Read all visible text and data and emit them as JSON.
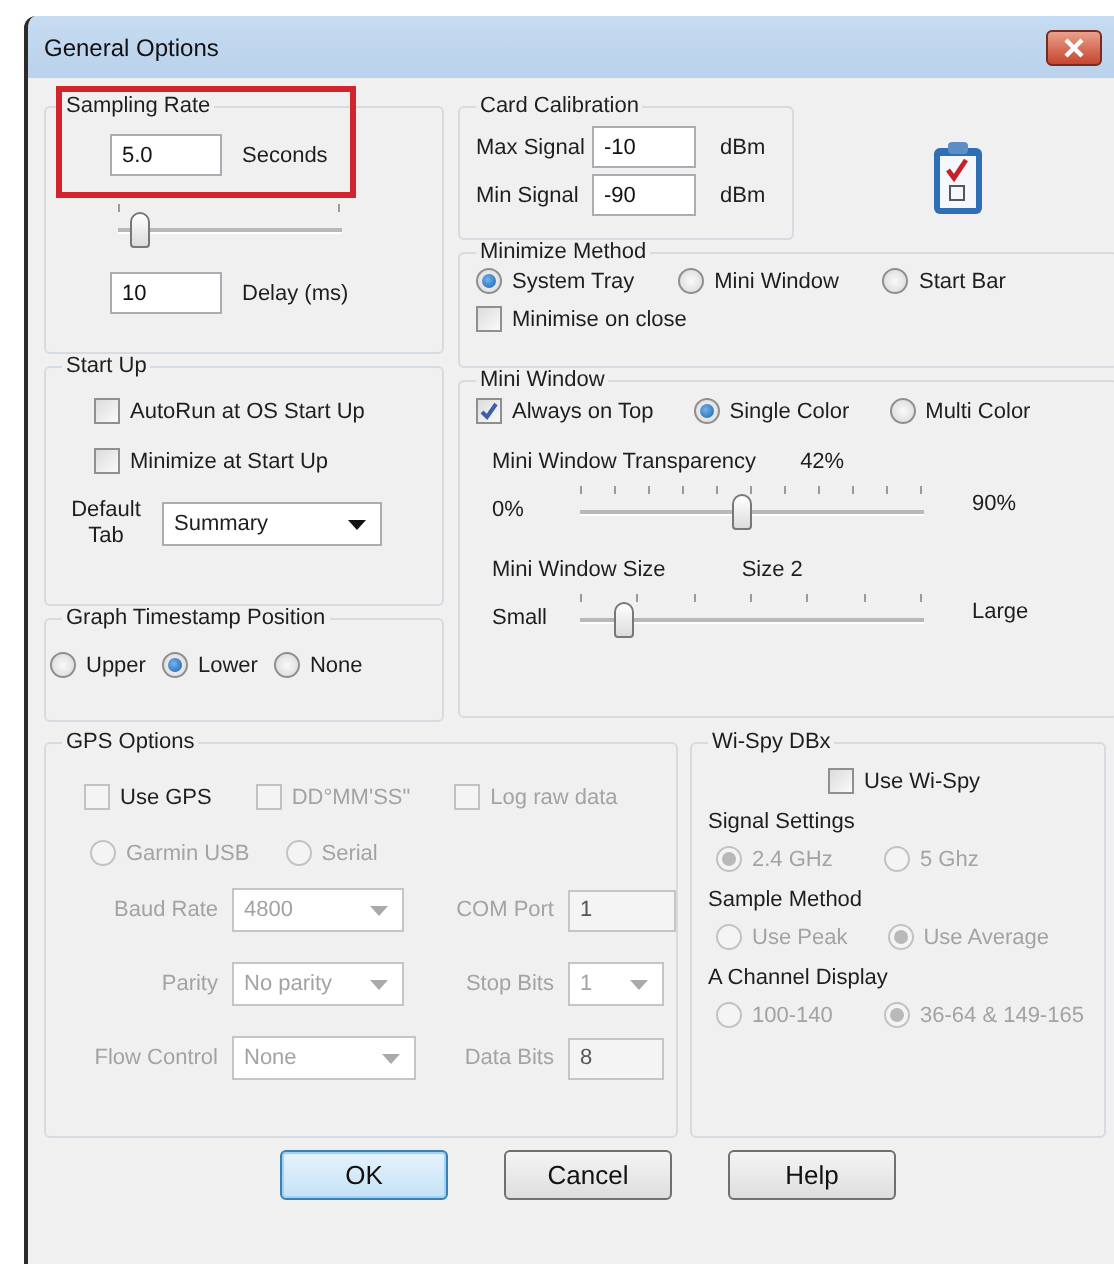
{
  "window": {
    "title": "General Options"
  },
  "sampling_rate": {
    "title": "Sampling Rate",
    "highlighted": true,
    "value": "5.0",
    "unit": "Seconds",
    "level": 0.1,
    "delay_value": "10",
    "delay_label": "Delay (ms)"
  },
  "card_calibration": {
    "title": "Card Calibration",
    "rows": [
      {
        "label": "Max Signal",
        "value": "-10",
        "unit": "dBm"
      },
      {
        "label": "Min Signal",
        "value": "-90",
        "unit": "dBm"
      }
    ]
  },
  "start_up": {
    "title": "Start Up",
    "options": [
      {
        "label": "AutoRun at OS Start Up",
        "checked": false
      },
      {
        "label": "Minimize at Start Up",
        "checked": false
      }
    ],
    "default_tab": {
      "label": "Default Tab",
      "value": "Summary"
    }
  },
  "graph_timestamp": {
    "title": "Graph Timestamp Position",
    "options": [
      {
        "label": "Upper",
        "selected": false
      },
      {
        "label": "Lower",
        "selected": true
      },
      {
        "label": "None",
        "selected": false
      }
    ]
  },
  "minimize_method": {
    "title": "Minimize Method",
    "options": [
      {
        "label": "System Tray",
        "selected": true
      },
      {
        "label": "Mini Window",
        "selected": false
      },
      {
        "label": "Start Bar",
        "selected": false
      }
    ],
    "minimise_on_close": {
      "label": "Minimise on close",
      "checked": false
    }
  },
  "mini_window": {
    "title": "Mini Window",
    "always_on_top": {
      "label": "Always on Top",
      "checked": true
    },
    "color_modes": [
      {
        "label": "Single Color",
        "selected": true
      },
      {
        "label": "Multi Color",
        "selected": false
      }
    ],
    "transparency": {
      "label": "Mini Window Transparency",
      "reading": "42%",
      "min": "0%",
      "max": "90%",
      "level": 0.47
    },
    "size": {
      "label": "Mini Window Size",
      "reading": "Size 2",
      "min": "Small",
      "max": "Large",
      "level": 0.13
    }
  },
  "gps": {
    "title": "GPS Options",
    "disabled": true,
    "checks": [
      {
        "label": "Use GPS",
        "checked": false
      },
      {
        "label": "DD°MM'SS\"",
        "checked": false
      },
      {
        "label": "Log raw data",
        "checked": false
      }
    ],
    "ports": [
      {
        "label": "Garmin USB",
        "selected": false
      },
      {
        "label": "Serial",
        "selected": false
      }
    ],
    "fields": [
      {
        "label": "Baud Rate",
        "kind": "select",
        "value": "4800"
      },
      {
        "label": "COM Port",
        "kind": "text",
        "value": "1"
      },
      {
        "label": "Parity",
        "kind": "select",
        "value": "No parity"
      },
      {
        "label": "Stop Bits",
        "kind": "select",
        "value": "1"
      },
      {
        "label": "Flow Control",
        "kind": "select",
        "value": "None"
      },
      {
        "label": "Data Bits",
        "kind": "text",
        "value": "8"
      }
    ]
  },
  "wispy": {
    "title": "Wi-Spy DBx",
    "use": {
      "label": "Use Wi-Spy",
      "checked": false
    },
    "disabled": true,
    "groups": [
      {
        "title": "Signal  Settings",
        "options": [
          {
            "label": "2.4 GHz",
            "selected": true
          },
          {
            "label": "5 Ghz",
            "selected": false
          }
        ]
      },
      {
        "title": "Sample Method",
        "options": [
          {
            "label": "Use Peak",
            "selected": false
          },
          {
            "label": "Use Average",
            "selected": true
          }
        ]
      },
      {
        "title": "A Channel Display",
        "options": [
          {
            "label": "100-140",
            "selected": false
          },
          {
            "label": "36-64 & 149-165",
            "selected": true
          }
        ]
      }
    ]
  },
  "buttons": [
    {
      "label": "OK",
      "default": true
    },
    {
      "label": "Cancel",
      "default": false
    },
    {
      "label": "Help",
      "default": false
    }
  ]
}
